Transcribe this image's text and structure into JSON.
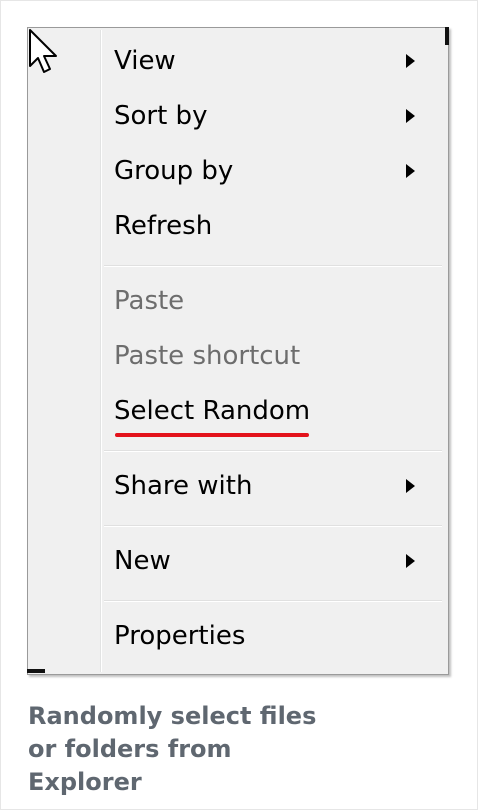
{
  "context_menu": {
    "items": [
      {
        "label": "View",
        "has_submenu": true,
        "disabled": false
      },
      {
        "label": "Sort by",
        "has_submenu": true,
        "disabled": false
      },
      {
        "label": "Group by",
        "has_submenu": true,
        "disabled": false
      },
      {
        "label": "Refresh",
        "has_submenu": false,
        "disabled": false
      },
      {
        "label": "Paste",
        "has_submenu": false,
        "disabled": true
      },
      {
        "label": "Paste shortcut",
        "has_submenu": false,
        "disabled": true
      },
      {
        "label": "Select Random",
        "has_submenu": false,
        "disabled": false,
        "highlighted_with_red_underline": true
      },
      {
        "label": "Share with",
        "has_submenu": true,
        "disabled": false
      },
      {
        "label": "New",
        "has_submenu": true,
        "disabled": false
      },
      {
        "label": "Properties",
        "has_submenu": false,
        "disabled": false
      }
    ]
  },
  "caption": {
    "line1": "Randomly select files",
    "line2": "or folders from",
    "line3": "Explorer"
  },
  "colors": {
    "menu_background": "#f0f0f0",
    "disabled_text": "#6d6d6d",
    "underline_red": "#e3121b",
    "caption_text": "#5f6770"
  },
  "icons": {
    "cursor": "mouse-pointer-icon",
    "submenu": "submenu-arrow-icon"
  }
}
